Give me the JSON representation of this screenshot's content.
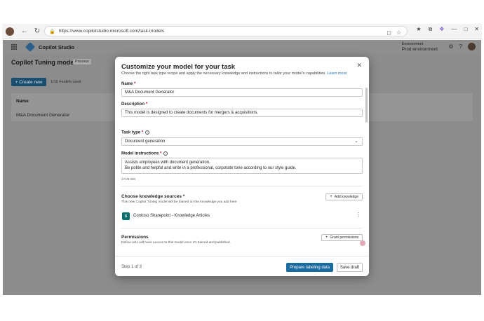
{
  "browser": {
    "url": "https://www.copilotstudio.microsoft.com/task-models"
  },
  "app": {
    "name": "Copilot Studio",
    "environment_label": "Environment",
    "environment_name": "Prod environment",
    "page_title": "Copilot Tuning models",
    "preview_badge": "Preview",
    "create_button": "+ Create new",
    "models_used": "1/10 models used",
    "table": {
      "header_name": "Name",
      "row_name": "M&A Document Generator"
    }
  },
  "modal": {
    "title": "Customize your model for your task",
    "subtitle": "Choose the right task type recipe and apply the necessary knowledge and instructions to tailor your model's capabilities.",
    "learn_more": "Learn more",
    "name_label": "Name",
    "name_value": "M&A Document Generator",
    "description_label": "Description",
    "description_value": "This model is designed to create documents for mergers & acquisitions.",
    "task_type_label": "Task type",
    "task_type_value": "Document generation",
    "instructions_label": "Model instructions",
    "instructions_line1": "Assists employees with document generation.",
    "instructions_line2": "Be polite and helpful and write in a professional, corporate tone according to our style guide.",
    "char_count": "171/8,000",
    "knowledge_title": "Choose knowledge sources",
    "knowledge_sub": "This new Copilot Tuning model will be trained on the knowledge you add here",
    "add_knowledge": "Add knowledge",
    "knowledge_item": "Contoso Sharepoint - Knowledge Articles",
    "permissions_title": "Permissions",
    "permissions_sub": "Define who will have access to this model once it's trained and published.",
    "grant_permissions": "Grant permissions",
    "step": "Step 1 of 3",
    "primary_button": "Prepare labeling data",
    "secondary_button": "Save draft"
  },
  "colors": {
    "primary": "#1a6ba0",
    "required": "#b10e1c",
    "link": "#1f6fb5"
  }
}
